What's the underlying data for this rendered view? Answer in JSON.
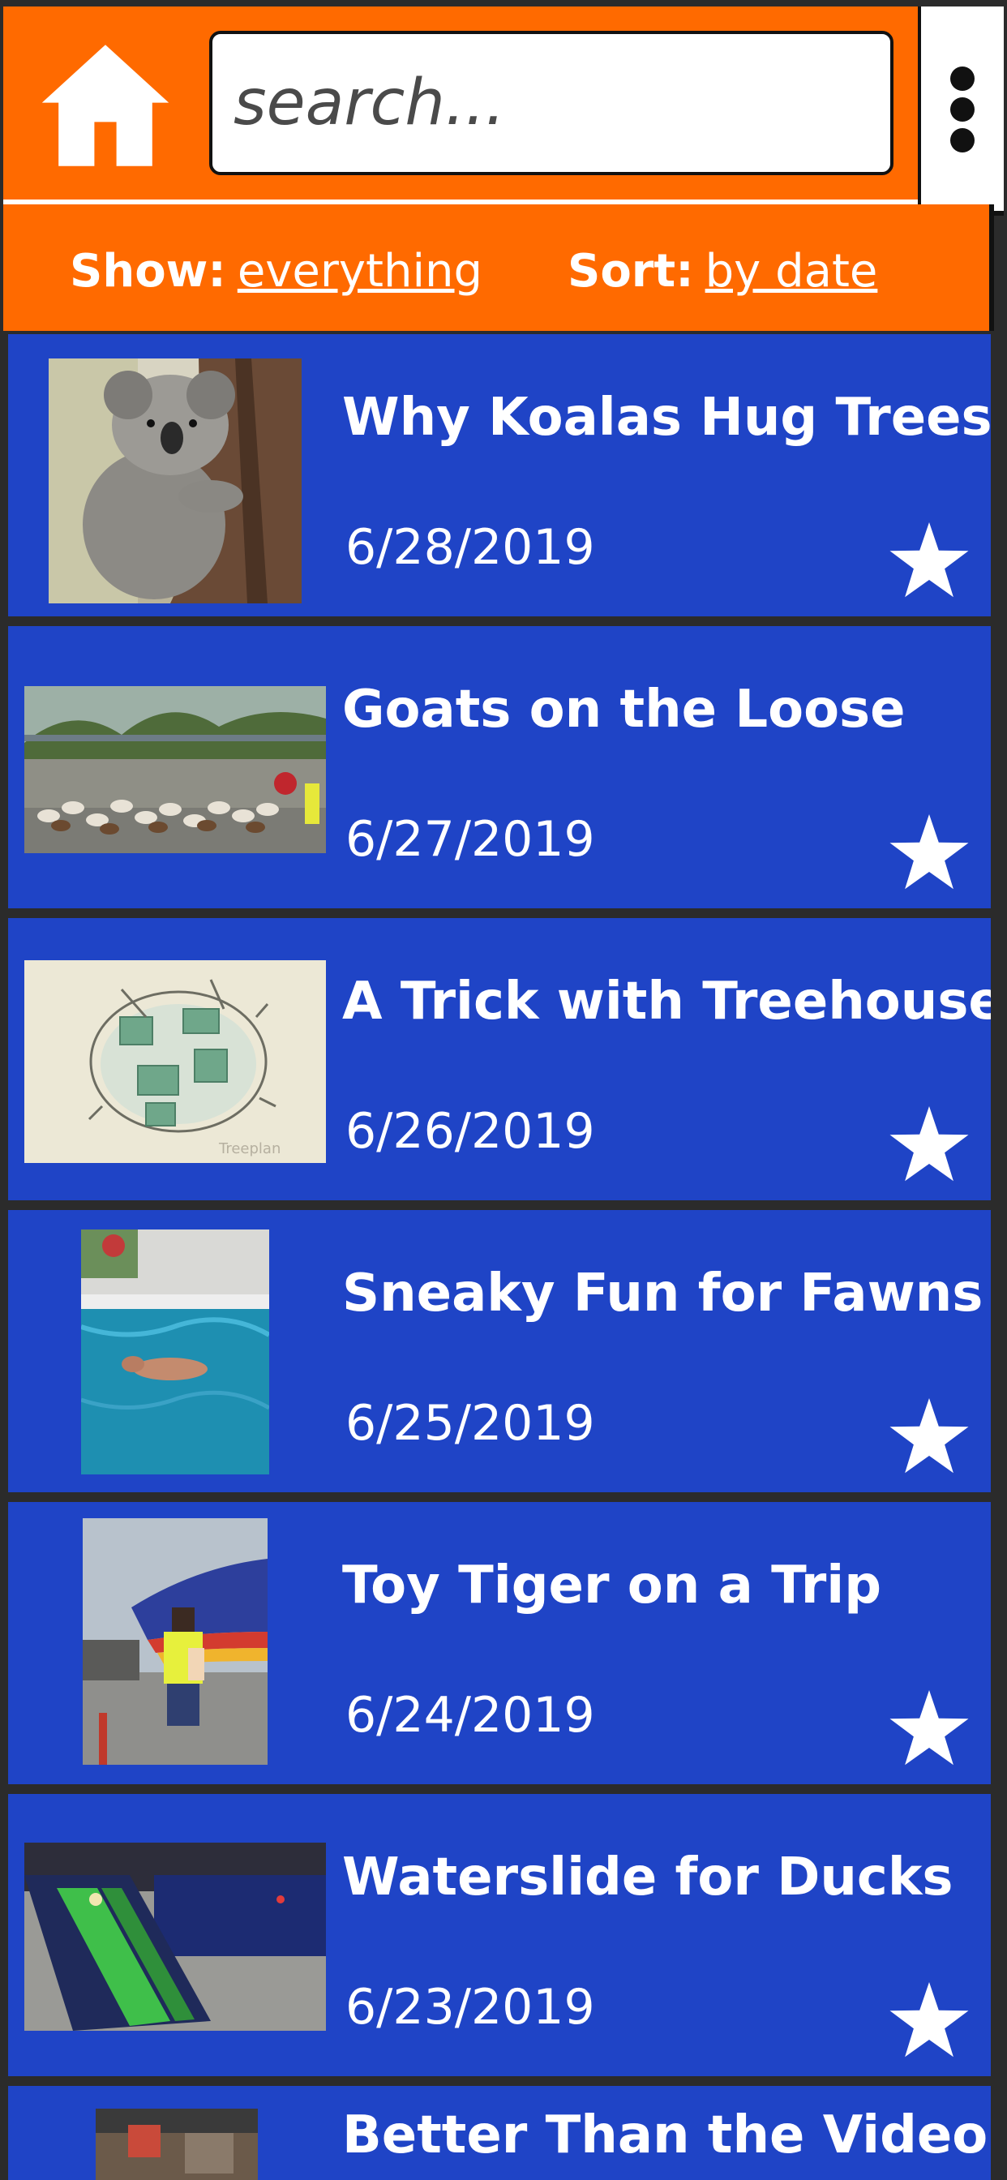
{
  "header": {
    "home_icon": "home-icon",
    "search": {
      "placeholder": "search...",
      "value": ""
    },
    "menu_icon": "kebab-menu-icon",
    "filters": {
      "show_label": "Show:",
      "show_value": "everything",
      "sort_label": "Sort:",
      "sort_value": "by date"
    }
  },
  "colors": {
    "header_orange": "#ff6a00",
    "item_blue": "#1f44c6",
    "text_white": "#ffffff",
    "border_dark": "#111111"
  },
  "items": [
    {
      "title": "Why Koalas Hug Trees",
      "date": "6/28/2019",
      "icon": "star-icon"
    },
    {
      "title": "Goats on the Loose",
      "date": "6/27/2019",
      "icon": "star-icon"
    },
    {
      "title": "A Trick with Treehouses",
      "date": "6/26/2019",
      "icon": "star-icon"
    },
    {
      "title": "Sneaky Fun for Fawns",
      "date": "6/25/2019",
      "icon": "star-icon"
    },
    {
      "title": "Toy Tiger on a Trip",
      "date": "6/24/2019",
      "icon": "star-icon"
    },
    {
      "title": "Waterslide for Ducks",
      "date": "6/23/2019",
      "icon": "star-icon"
    },
    {
      "title": "Better Than the Video",
      "date": "",
      "icon": "star-icon"
    }
  ]
}
